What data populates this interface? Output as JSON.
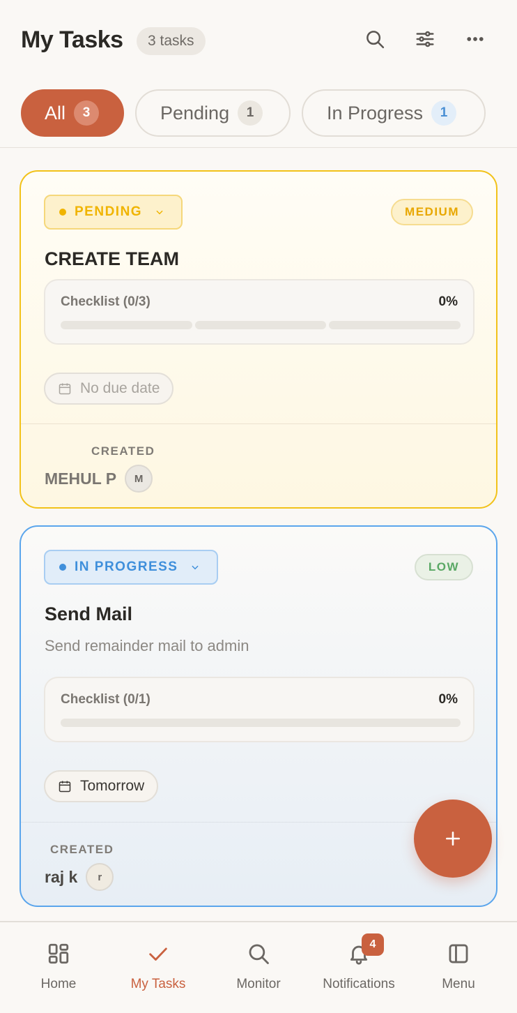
{
  "header": {
    "title": "My Tasks",
    "count_badge": "3 tasks",
    "icons": [
      "search-icon",
      "filter-sliders-icon",
      "more-horizontal-icon"
    ]
  },
  "tabs": [
    {
      "label": "All",
      "count": "3",
      "active": true
    },
    {
      "label": "Pending",
      "count": "1",
      "active": false
    },
    {
      "label": "In Progress",
      "count": "1",
      "active": false
    }
  ],
  "tasks": [
    {
      "status": "PENDING",
      "priority": "MEDIUM",
      "title": "CREATE TEAM",
      "description": "",
      "checklist_label": "Checklist (0/3)",
      "checklist_pct": "0%",
      "checklist_progress": 0,
      "due": "No due date",
      "created_label": "CREATED",
      "creator": "MEHUL P",
      "avatar": "M"
    },
    {
      "status": "IN PROGRESS",
      "priority": "LOW",
      "title": "Send Mail",
      "description": "Send remainder mail to admin",
      "checklist_label": "Checklist (0/1)",
      "checklist_pct": "0%",
      "checklist_progress": 0,
      "due": "Tomorrow",
      "created_label": "CREATED",
      "creator": "raj k",
      "avatar": "r"
    }
  ],
  "nav": [
    {
      "label": "Home",
      "icon": "home-grid-icon",
      "active": false
    },
    {
      "label": "My Tasks",
      "icon": "check-icon",
      "active": true
    },
    {
      "label": "Monitor",
      "icon": "search-icon",
      "active": false
    },
    {
      "label": "Notifications",
      "icon": "bell-icon",
      "active": false,
      "badge": "4"
    },
    {
      "label": "Menu",
      "icon": "sidebar-panel-icon",
      "active": false
    }
  ],
  "colors": {
    "accent": "#c9613f",
    "pending": "#f0b400",
    "in_progress": "#3f8fdb",
    "low": "#5aa865"
  }
}
